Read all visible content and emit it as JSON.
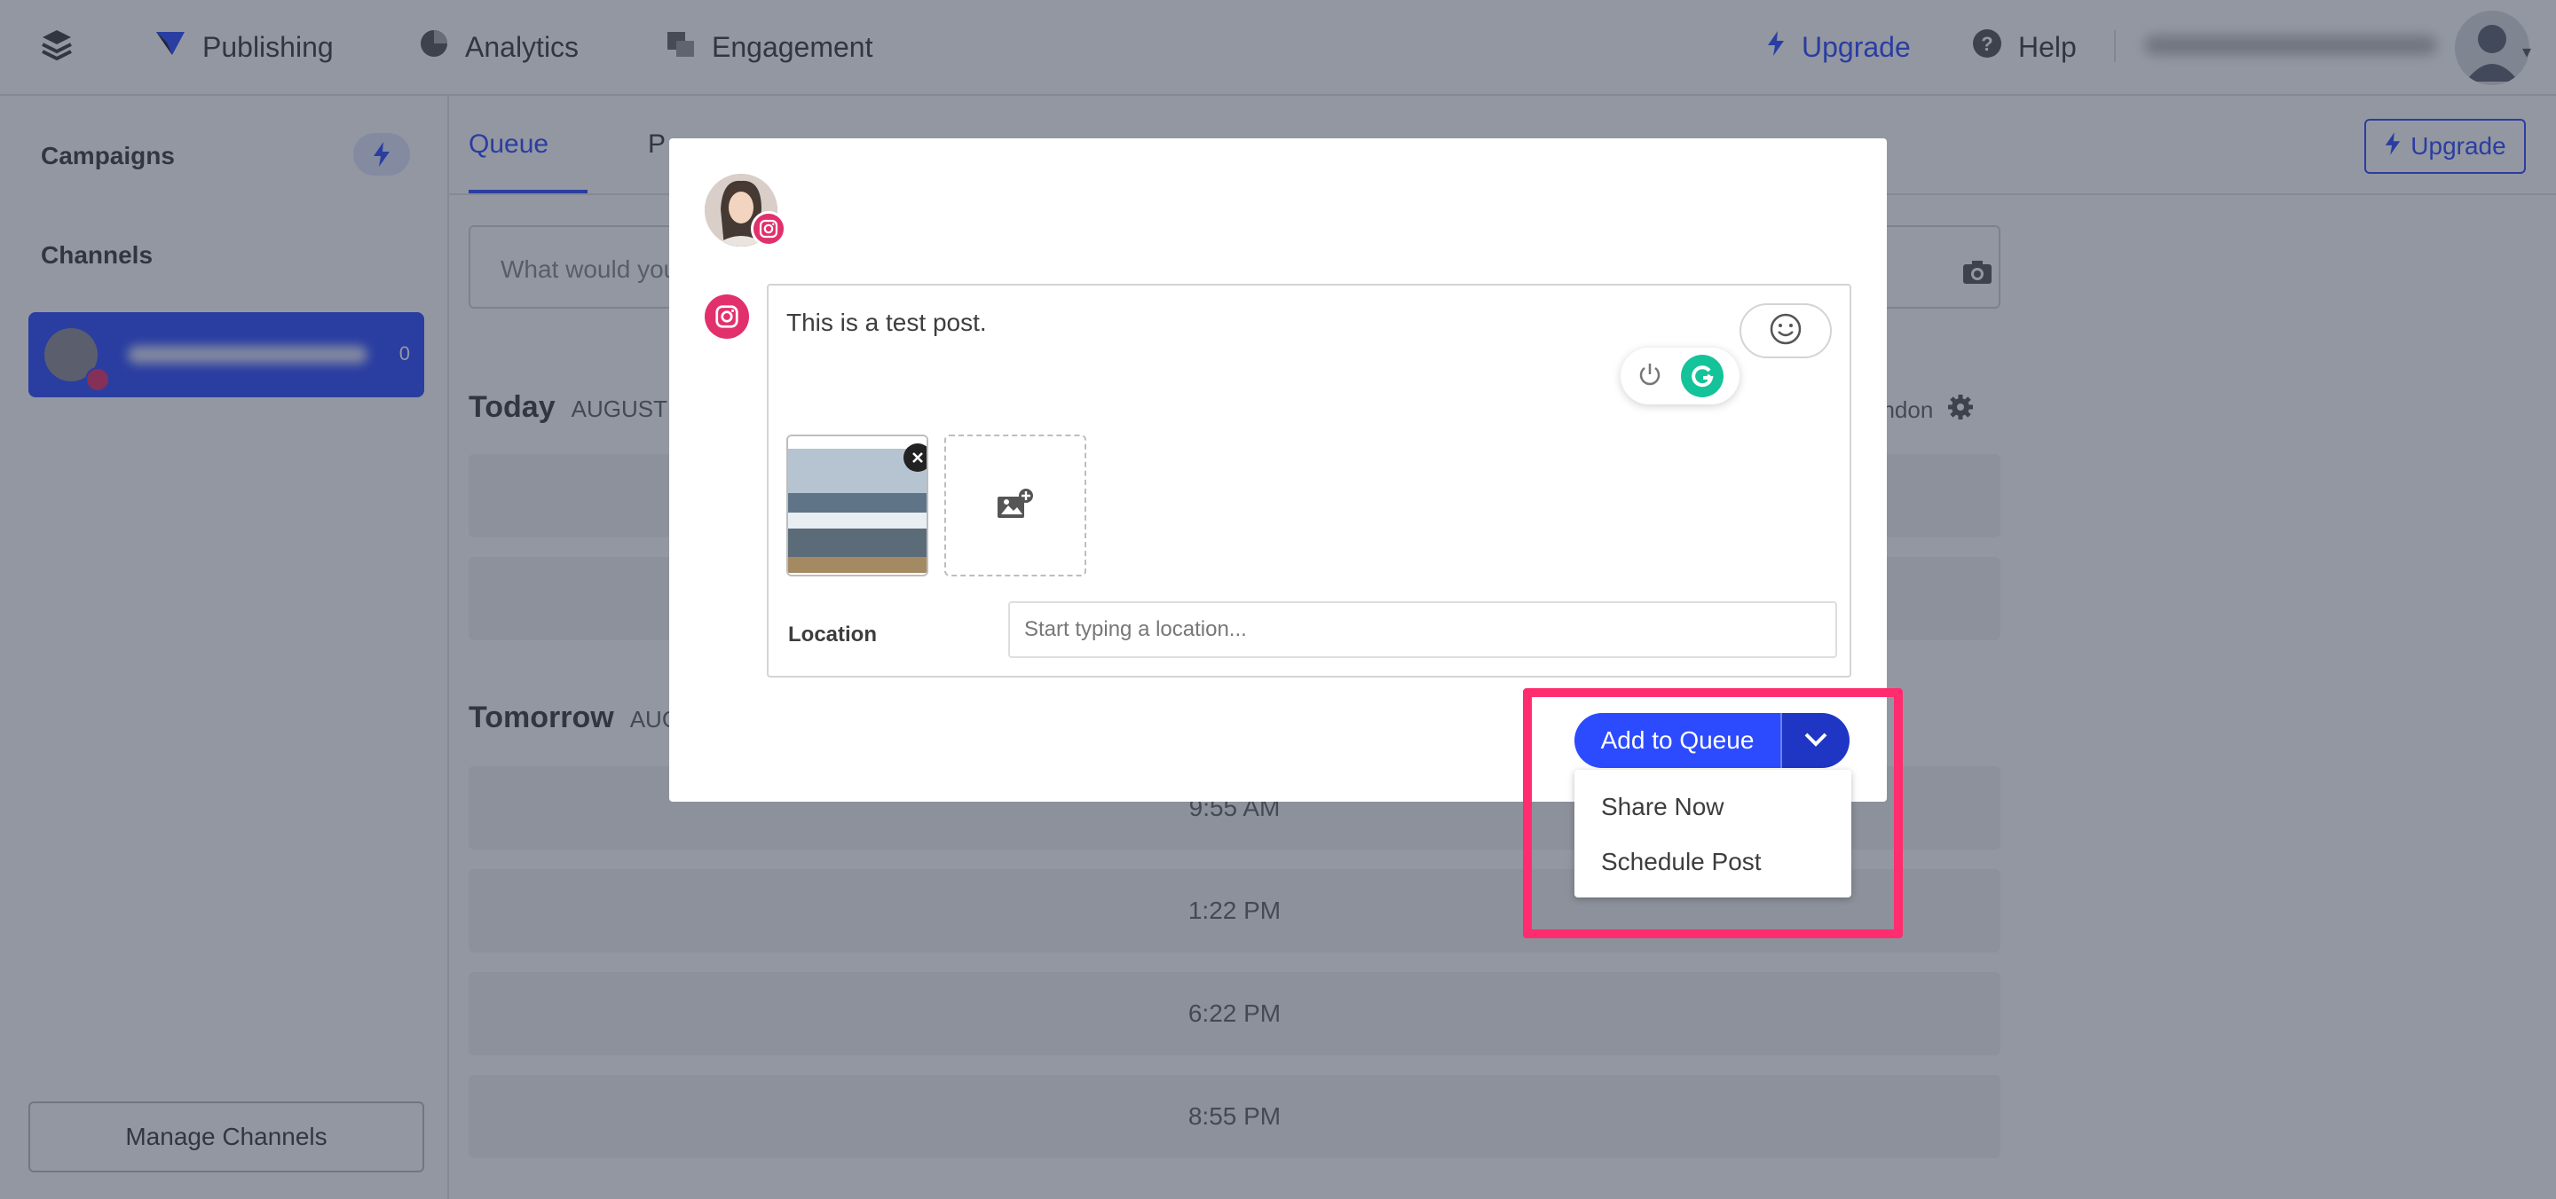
{
  "colors": {
    "accent": "#2c4bff",
    "instagram": "#e1306c",
    "grammarly": "#15c39a",
    "highlight": "#ff2d6f"
  },
  "topnav": {
    "logo_icon": "layers-icon",
    "items": [
      {
        "label": "Publishing",
        "icon": "publish-icon"
      },
      {
        "label": "Analytics",
        "icon": "pie-chart-icon"
      },
      {
        "label": "Engagement",
        "icon": "engagement-icon"
      }
    ],
    "upgrade_label": "Upgrade",
    "help_label": "Help"
  },
  "sidebar": {
    "campaigns_label": "Campaigns",
    "channels_label": "Channels",
    "channel": {
      "count": "0"
    },
    "manage_label": "Manage Channels"
  },
  "main": {
    "tabs": [
      {
        "label": "Queue",
        "active": true
      },
      {
        "label": "P",
        "active": false
      }
    ],
    "upgrade_label": "Upgrade",
    "composer_placeholder": "What would you",
    "today_label": "Today",
    "today_sub": "AUGUST",
    "tomorrow_label": "Tomorrow",
    "tomorrow_sub": "AUG",
    "timezone_label": "ondon",
    "slots": [
      "9:55 AM",
      "1:22 PM",
      "6:22 PM",
      "8:55 PM"
    ]
  },
  "modal": {
    "post_text": "This is a test post.",
    "location_label": "Location",
    "location_placeholder": "Start typing a location...",
    "add_to_queue_label": "Add to Queue",
    "dropdown_items": [
      "Share Now",
      "Schedule Post"
    ]
  }
}
